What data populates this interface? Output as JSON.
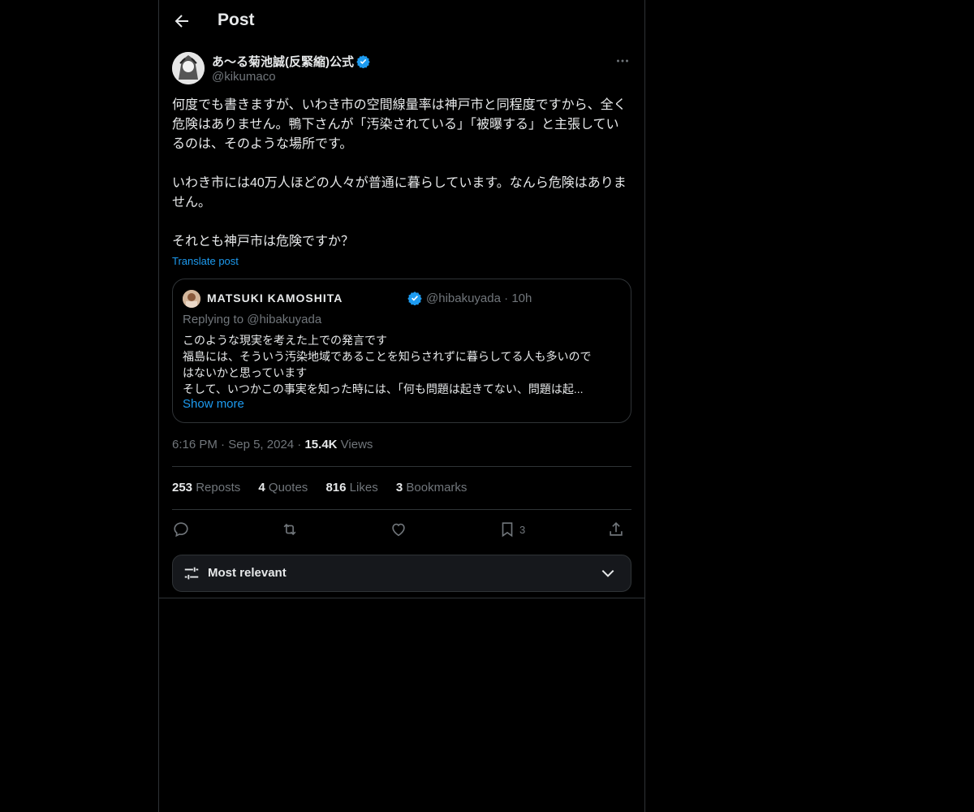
{
  "header": {
    "title": "Post"
  },
  "post": {
    "author_name": "あ〜る菊池誠(反緊縮)公式",
    "author_handle": "@kikumaco",
    "body": "何度でも書きますが、いわき市の空間線量率は神戸市と同程度ですから、全く危険はありません。鴨下さんが「汚染されている」「被曝する」と主張しているのは、そのような場所です。\n\nいわき市には40万人ほどの人々が普通に暮らしています。なんら危険はありません。\n\nそれとも神戸市は危険ですか？",
    "translate_label": "Translate post",
    "time": "6:16 PM",
    "date": "Sep 5, 2024",
    "views_count": "15.4K",
    "views_label": "Views"
  },
  "quote": {
    "name": "MATSUKI KAMOSHITA",
    "handle": "@hibakuyada",
    "sep": "·",
    "age": "10h",
    "replying_prefix": "Replying to",
    "replying_handle": "@hibakuyada",
    "lines": [
      "このような現実を考えた上での発言です",
      "福島には、そういう汚染地域であることを知らされずに暮らしてる人も多いので",
      "はないかと思っています",
      "そして、いつかこの事実を知った時には、「何も問題は起きてない、問題は起..."
    ],
    "show_more": "Show more"
  },
  "stats": {
    "reposts_count": "253",
    "reposts_label": "Reposts",
    "quotes_count": "4",
    "quotes_label": "Quotes",
    "likes_count": "816",
    "likes_label": "Likes",
    "bookmarks_count": "3",
    "bookmarks_label": "Bookmarks"
  },
  "actions": {
    "bookmark_count": "3"
  },
  "sort": {
    "label": "Most relevant"
  },
  "icons": {
    "back": "arrow-left-icon",
    "verified": "verified-badge-icon",
    "more": "more-dots-icon",
    "reply": "reply-icon",
    "repost": "repost-icon",
    "like": "heart-icon",
    "bookmark": "bookmark-icon",
    "share": "share-icon",
    "sort": "sliders-icon",
    "chevron": "chevron-down-icon"
  },
  "colors": {
    "background": "#000000",
    "text": "#e7e9ea",
    "muted": "#71767b",
    "accent": "#1d9bf0",
    "border": "#2f3336"
  }
}
